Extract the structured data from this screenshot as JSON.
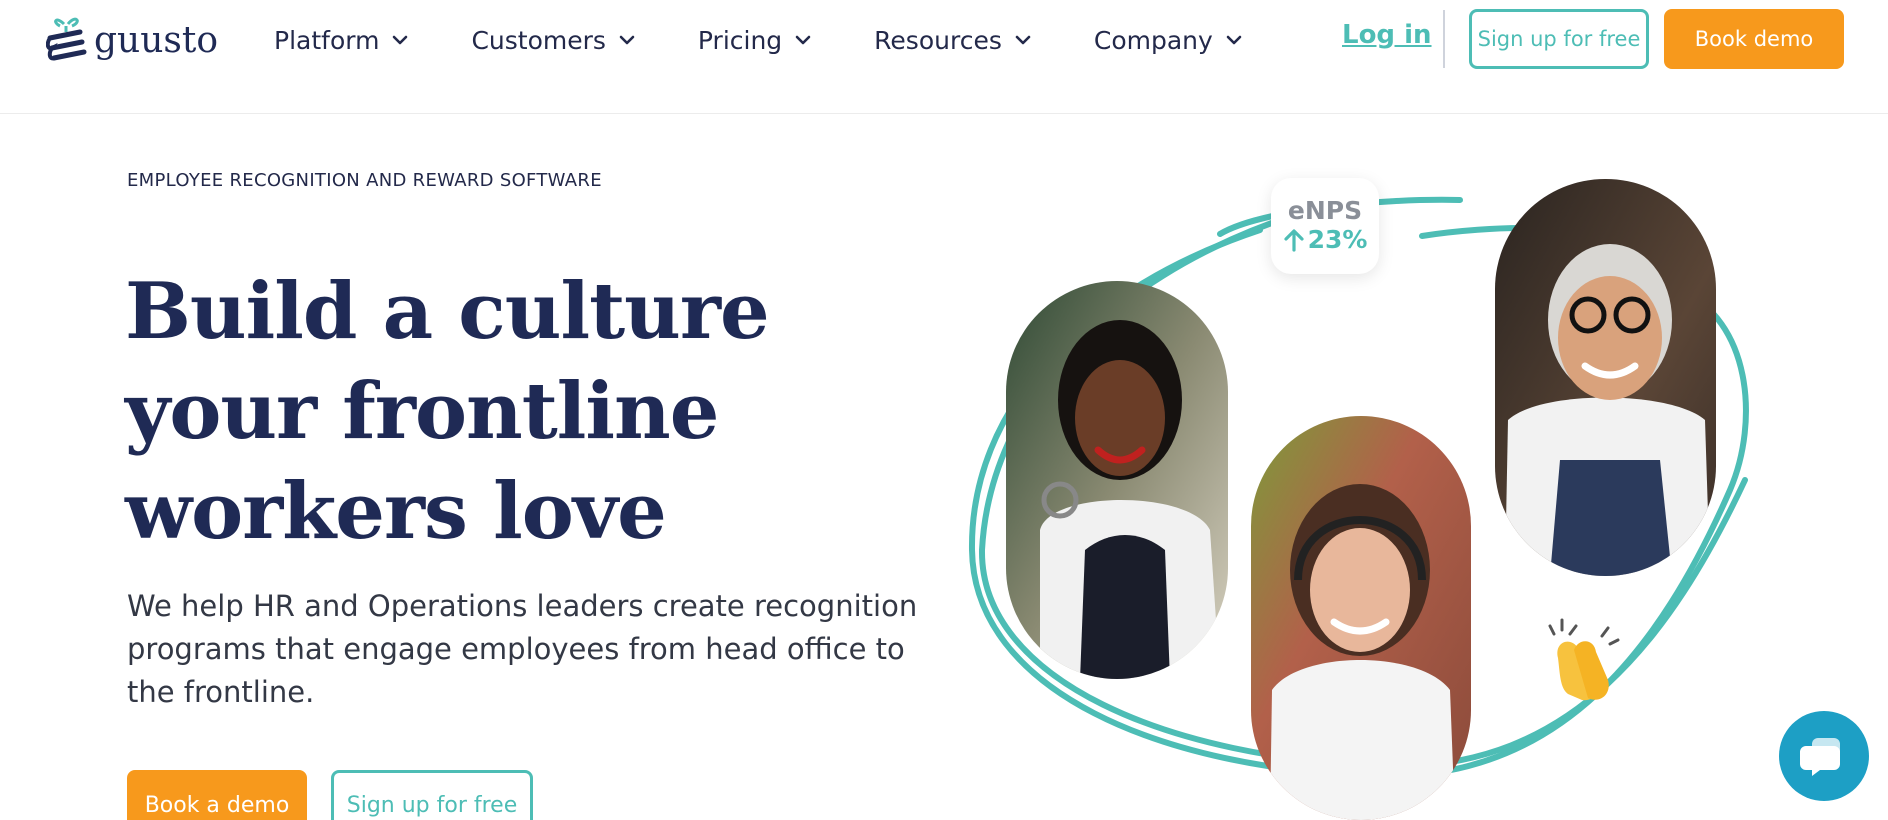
{
  "brand": {
    "name": "guusto",
    "accent": "#4dbdb5",
    "orange": "#f7991c",
    "navy": "#1f2a55"
  },
  "nav": {
    "items": [
      {
        "label": "Platform"
      },
      {
        "label": "Customers"
      },
      {
        "label": "Pricing"
      },
      {
        "label": "Resources"
      },
      {
        "label": "Company"
      }
    ],
    "login_label": "Log in",
    "signup_label": "Sign up for free",
    "demo_label": "Book demo"
  },
  "hero": {
    "eyebrow": "EMPLOYEE RECOGNITION AND REWARD SOFTWARE",
    "headline": "Build a culture your frontline workers love",
    "subtext": "We help HR and Operations leaders create recognition programs that engage employees from head office to the frontline.",
    "cta_primary": "Book a demo",
    "cta_secondary": "Sign up for free"
  },
  "badge": {
    "label": "eNPS",
    "value": "23%"
  },
  "icons": [
    "gift-logo-icon",
    "chevron-down-icon",
    "arrow-up-icon",
    "clapping-hands-icon",
    "chat-icon"
  ]
}
